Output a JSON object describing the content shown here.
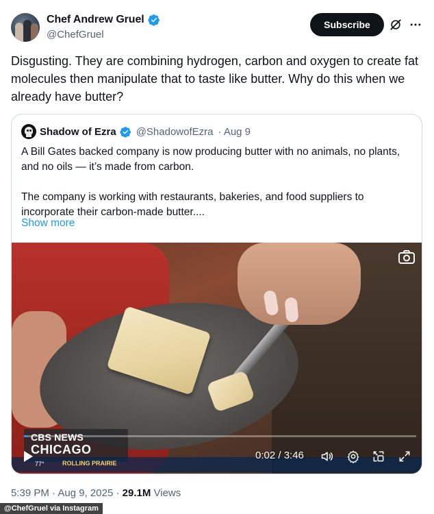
{
  "author": {
    "display_name": "Chef Andrew Gruel",
    "handle": "@ChefGruel",
    "verified": true
  },
  "actions": {
    "subscribe_label": "Subscribe",
    "grok_icon": "grok-icon",
    "more_icon": "more-dots-icon"
  },
  "tweet": {
    "text": "Disgusting. They are combining hydrogen, carbon and oxygen to create fat molecules then manipulate that to taste like butter. Why do this when we already have butter?"
  },
  "quote": {
    "display_name": "Shadow of Ezra",
    "handle": "@ShadowofEzra",
    "date": "· Aug 9",
    "paragraph_1": "A Bill Gates backed company is now producing butter with no animals, no plants, and no oils — it’s made from carbon.",
    "paragraph_2": "The company is working with restaurants, bakeries, and food suppliers to incorporate their carbon-made butter....",
    "show_more": "Show more"
  },
  "video": {
    "station_top": "CBS NEWS",
    "station_city": "CHICAGO",
    "ticker_temp": "77°",
    "ticker_town": "ROLLING PRAIRIE",
    "time": "0:02 / 3:46",
    "progress_fraction": 0.009,
    "accent": "#1d9bf0"
  },
  "footer": {
    "time": "5:39 PM",
    "sep": "·",
    "date": "Aug 9, 2025",
    "views_count": "29.1M",
    "views_label": "Views"
  },
  "credit": "@ChefGruel via Instagram"
}
